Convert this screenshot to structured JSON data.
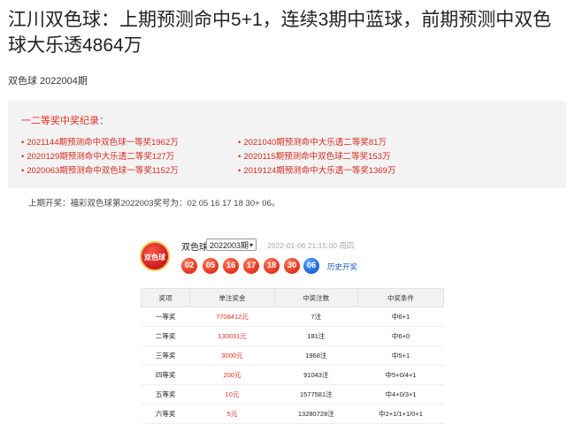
{
  "article": {
    "title": "江川双色球：上期预测命中5+1，连续3期中蓝球，前期预测中双色球大乐透4864万",
    "subtitle": "双色球 2022004期"
  },
  "records": {
    "title": "一二等奖中奖纪录：",
    "left": [
      "2021144期预测命中双色球一等奖1962万",
      "2020129期预测命中大乐透二等奖127万",
      "2020063期预测命中双色球一等奖1152万"
    ],
    "right": [
      "2021040期预测命中大乐透二等奖81万",
      "2020115期预测命中双色球二等奖153万",
      "2019124期预测命中大乐透一等奖1369万"
    ]
  },
  "previous_draw": "上期开奖：福彩双色球第2022003奖号为：02 05 16 17 18 30+ 06。",
  "lottery": {
    "logo_text": "双色球",
    "name": "双色球",
    "issue": "2022003期",
    "time": "2022-01-06 21:15:00 周四",
    "red_balls": [
      "02",
      "05",
      "16",
      "17",
      "18",
      "30"
    ],
    "blue_ball": "06",
    "history_link": "历史开奖",
    "colors": {
      "red": "#e2331b",
      "blue": "#1a63d1"
    }
  },
  "prize_table": {
    "headers": [
      "奖项",
      "单注奖金",
      "中奖注数",
      "中奖条件"
    ],
    "rows": [
      [
        "一等奖",
        "7708412元",
        "7注",
        "中6+1"
      ],
      [
        "二等奖",
        "130031元",
        "181注",
        "中6+0"
      ],
      [
        "三等奖",
        "3000元",
        "1968注",
        "中5+1"
      ],
      [
        "四等奖",
        "200元",
        "91043注",
        "中5+0/4+1"
      ],
      [
        "五等奖",
        "10元",
        "1577581注",
        "中4+0/3+1"
      ],
      [
        "六等奖",
        "5元",
        "13280728注",
        "中2+1/1+1/0+1"
      ]
    ]
  }
}
